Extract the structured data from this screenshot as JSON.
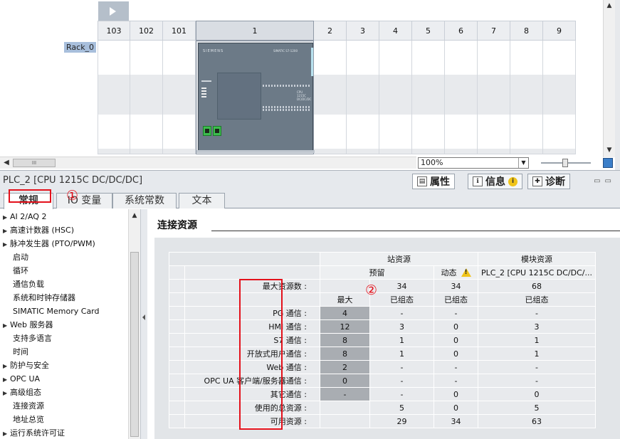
{
  "rack": {
    "label": "Rack_0",
    "slots": [
      "103",
      "102",
      "101",
      "1",
      "2",
      "3",
      "4",
      "5",
      "6",
      "7",
      "8",
      "9"
    ],
    "selected_slot": "1",
    "zoom": "100%",
    "hscroll_thumb": "III"
  },
  "cpu_module": {
    "brand": "SIEMENS",
    "model_text": "SIMATIC S7-1200",
    "cpu_text": "CPU 1215C DC/DC/DC"
  },
  "inspector": {
    "object_title": "PLC_2 [CPU 1215C DC/DC/DC]",
    "tabs": [
      {
        "label": "属性",
        "icon": "properties-icon"
      },
      {
        "label": "信息",
        "icon": "info-icon"
      },
      {
        "label": "诊断",
        "icon": "diagnostics-icon"
      }
    ],
    "info_badge": "i"
  },
  "subtabs": [
    "常规",
    "IO 变量",
    "系统常数",
    "文本"
  ],
  "nav": {
    "items": [
      {
        "label": "AI 2/AQ 2",
        "expandable": true
      },
      {
        "label": "高速计数器 (HSC)",
        "expandable": true
      },
      {
        "label": "脉冲发生器 (PTO/PWM)",
        "expandable": true
      },
      {
        "label": "启动",
        "expandable": false
      },
      {
        "label": "循环",
        "expandable": false
      },
      {
        "label": "通信负载",
        "expandable": false
      },
      {
        "label": "系统和时钟存储器",
        "expandable": false
      },
      {
        "label": "SIMATIC Memory Card",
        "expandable": false
      },
      {
        "label": "Web 服务器",
        "expandable": true
      },
      {
        "label": "支持多语言",
        "expandable": false
      },
      {
        "label": "时间",
        "expandable": false
      },
      {
        "label": "防护与安全",
        "expandable": true
      },
      {
        "label": "OPC UA",
        "expandable": true
      },
      {
        "label": "高级组态",
        "expandable": true
      },
      {
        "label": "连接资源",
        "expandable": false
      },
      {
        "label": "地址总览",
        "expandable": false
      },
      {
        "label": "运行系统许可证",
        "expandable": true
      }
    ],
    "selected": "连接资源",
    "annotation": "①"
  },
  "section": {
    "title": "连接资源",
    "annotation": "②"
  },
  "table": {
    "group_station": "站资源",
    "group_module": "模块资源",
    "sub_reserved": "预留",
    "sub_dynamic": "动态",
    "sub_module": "PLC_2 [CPU 1215C DC/DC/...",
    "max_label": "最大资源数 :",
    "max_values": {
      "reserved": "34",
      "dynamic": "34",
      "module": "68"
    },
    "col_max": "最大",
    "col_configured": "已组态",
    "rows": [
      {
        "label": "PG 通信 :",
        "max": "4",
        "configured": "-",
        "dynamic": "-",
        "module": "-"
      },
      {
        "label": "HMI 通信 :",
        "max": "12",
        "configured": "3",
        "dynamic": "0",
        "module": "3"
      },
      {
        "label": "S7 通信 :",
        "max": "8",
        "configured": "1",
        "dynamic": "0",
        "module": "1"
      },
      {
        "label": "开放式用户通信 :",
        "max": "8",
        "configured": "1",
        "dynamic": "0",
        "module": "1"
      },
      {
        "label": "Web 通信 :",
        "max": "2",
        "configured": "-",
        "dynamic": "-",
        "module": "-"
      },
      {
        "label": "OPC UA 客户端/服务器通信 :",
        "max": "0",
        "configured": "-",
        "dynamic": "-",
        "module": "-"
      },
      {
        "label": "其它通信 :",
        "max": "-",
        "configured": "-",
        "dynamic": "0",
        "module": "0"
      }
    ],
    "total_label": "使用的总资源 :",
    "total": {
      "configured": "5",
      "dynamic": "0",
      "module": "5"
    },
    "avail_label": "可用资源 :",
    "available": {
      "configured": "29",
      "dynamic": "34",
      "module": "63"
    }
  }
}
